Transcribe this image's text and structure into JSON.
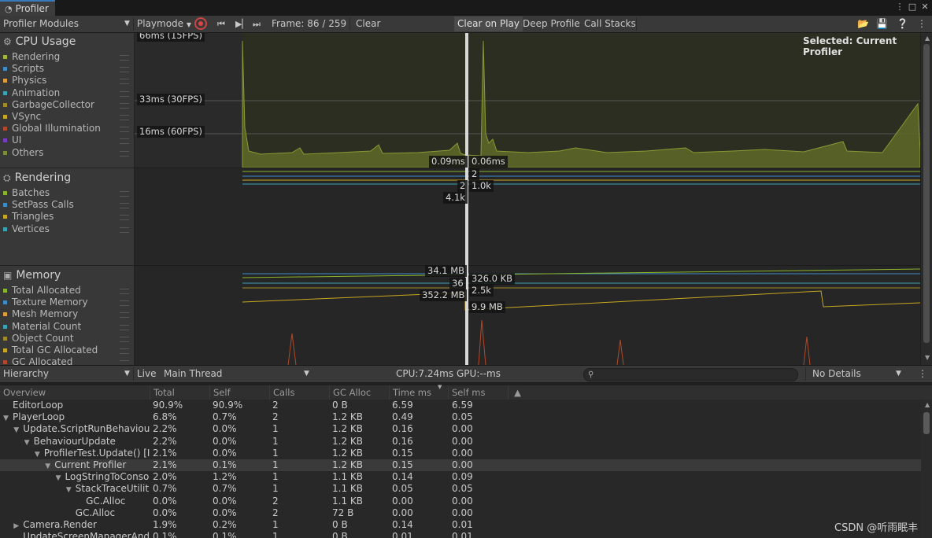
{
  "window": {
    "tab_title": "Profiler"
  },
  "toolbar": {
    "modules_label": "Profiler Modules",
    "playmode_label": "Playmode",
    "frame_text": "Frame: 86 / 259",
    "clear": "Clear",
    "clear_on_play": "Clear on Play",
    "deep_profile": "Deep Profile",
    "call_stacks": "Call Stacks"
  },
  "modules": {
    "cpu": {
      "title": "CPU Usage",
      "items": [
        {
          "label": "Rendering",
          "color": "#a2b63a"
        },
        {
          "label": "Scripts",
          "color": "#3d8cc7"
        },
        {
          "label": "Physics",
          "color": "#e09e3a"
        },
        {
          "label": "Animation",
          "color": "#3aa3b6"
        },
        {
          "label": "GarbageCollector",
          "color": "#a28c28"
        },
        {
          "label": "VSync",
          "color": "#c8a81f"
        },
        {
          "label": "Global Illumination",
          "color": "#b4482a"
        },
        {
          "label": "UI",
          "color": "#7a3ac8"
        },
        {
          "label": "Others",
          "color": "#7a8c3a"
        }
      ]
    },
    "rendering": {
      "title": "Rendering",
      "items": [
        {
          "label": "Batches",
          "color": "#8ab62a"
        },
        {
          "label": "SetPass Calls",
          "color": "#3d8cc7"
        },
        {
          "label": "Triangles",
          "color": "#c8a81f"
        },
        {
          "label": "Vertices",
          "color": "#3aa3b6"
        }
      ]
    },
    "memory": {
      "title": "Memory",
      "items": [
        {
          "label": "Total Allocated",
          "color": "#8ab62a"
        },
        {
          "label": "Texture Memory",
          "color": "#3d8cc7"
        },
        {
          "label": "Mesh Memory",
          "color": "#e09e3a"
        },
        {
          "label": "Material Count",
          "color": "#3aa3b6"
        },
        {
          "label": "Object Count",
          "color": "#a28c28"
        },
        {
          "label": "Total GC Allocated",
          "color": "#c8a81f"
        },
        {
          "label": "GC Allocated",
          "color": "#b4482a"
        }
      ]
    }
  },
  "charts": {
    "selected_text": "Selected: Current Profiler",
    "cpu_lines": [
      "66ms (15FPS)",
      "33ms (30FPS)",
      "16ms (60FPS)"
    ],
    "cpu_values": [
      "0.09ms",
      "0.06ms"
    ],
    "render_values": [
      "2",
      "2",
      "1.0k",
      "4.1k"
    ],
    "memory_values": [
      "34.1 MB",
      "36",
      "326.0 KB",
      "2.5k",
      "352.2 MB",
      "9.9 MB"
    ]
  },
  "hierarchy_toolbar": {
    "view": "Hierarchy",
    "live": "Live",
    "thread": "Main Thread",
    "cpu": "CPU:7.24ms",
    "gpu": "GPU:--ms",
    "search_placeholder": "",
    "details": "No Details"
  },
  "table": {
    "columns": [
      "Overview",
      "Total",
      "Self",
      "Calls",
      "GC Alloc",
      "Time ms",
      "Self ms"
    ],
    "rows": [
      {
        "name": "EditorLoop",
        "indent": 0,
        "arrow": "",
        "total": "90.9%",
        "self": "90.9%",
        "calls": "2",
        "gc": "0 B",
        "time": "6.59",
        "selfms": "6.59"
      },
      {
        "name": "PlayerLoop",
        "indent": 0,
        "arrow": "▼",
        "total": "6.8%",
        "self": "0.7%",
        "calls": "2",
        "gc": "1.2 KB",
        "time": "0.49",
        "selfms": "0.05"
      },
      {
        "name": "Update.ScriptRunBehaviourU",
        "indent": 1,
        "arrow": "▼",
        "total": "2.2%",
        "self": "0.0%",
        "calls": "1",
        "gc": "1.2 KB",
        "time": "0.16",
        "selfms": "0.00"
      },
      {
        "name": "BehaviourUpdate",
        "indent": 2,
        "arrow": "▼",
        "total": "2.2%",
        "self": "0.0%",
        "calls": "1",
        "gc": "1.2 KB",
        "time": "0.16",
        "selfms": "0.00"
      },
      {
        "name": "ProfilerTest.Update() [Inv",
        "indent": 3,
        "arrow": "▼",
        "total": "2.1%",
        "self": "0.0%",
        "calls": "1",
        "gc": "1.2 KB",
        "time": "0.15",
        "selfms": "0.00"
      },
      {
        "name": "Current Profiler",
        "indent": 4,
        "arrow": "▼",
        "total": "2.1%",
        "self": "0.1%",
        "calls": "1",
        "gc": "1.2 KB",
        "time": "0.15",
        "selfms": "0.00",
        "selected": true
      },
      {
        "name": "LogStringToConsol",
        "indent": 5,
        "arrow": "▼",
        "total": "2.0%",
        "self": "1.2%",
        "calls": "1",
        "gc": "1.1 KB",
        "time": "0.14",
        "selfms": "0.09"
      },
      {
        "name": "StackTraceUtilit",
        "indent": 6,
        "arrow": "▼",
        "total": "0.7%",
        "self": "0.7%",
        "calls": "1",
        "gc": "1.1 KB",
        "time": "0.05",
        "selfms": "0.05"
      },
      {
        "name": "GC.Alloc",
        "indent": 7,
        "arrow": "",
        "total": "0.0%",
        "self": "0.0%",
        "calls": "2",
        "gc": "1.1 KB",
        "time": "0.00",
        "selfms": "0.00"
      },
      {
        "name": "GC.Alloc",
        "indent": 6,
        "arrow": "",
        "total": "0.0%",
        "self": "0.0%",
        "calls": "2",
        "gc": "72 B",
        "time": "0.00",
        "selfms": "0.00"
      },
      {
        "name": "Camera.Render",
        "indent": 1,
        "arrow": "▶",
        "total": "1.9%",
        "self": "0.2%",
        "calls": "1",
        "gc": "0 B",
        "time": "0.14",
        "selfms": "0.01"
      },
      {
        "name": "UpdateScreenManagerAndIn",
        "indent": 1,
        "arrow": "",
        "total": "0.1%",
        "self": "0.1%",
        "calls": "1",
        "gc": "0 B",
        "time": "0.01",
        "selfms": "0.01"
      }
    ]
  },
  "watermark": "CSDN @听雨眠丰"
}
